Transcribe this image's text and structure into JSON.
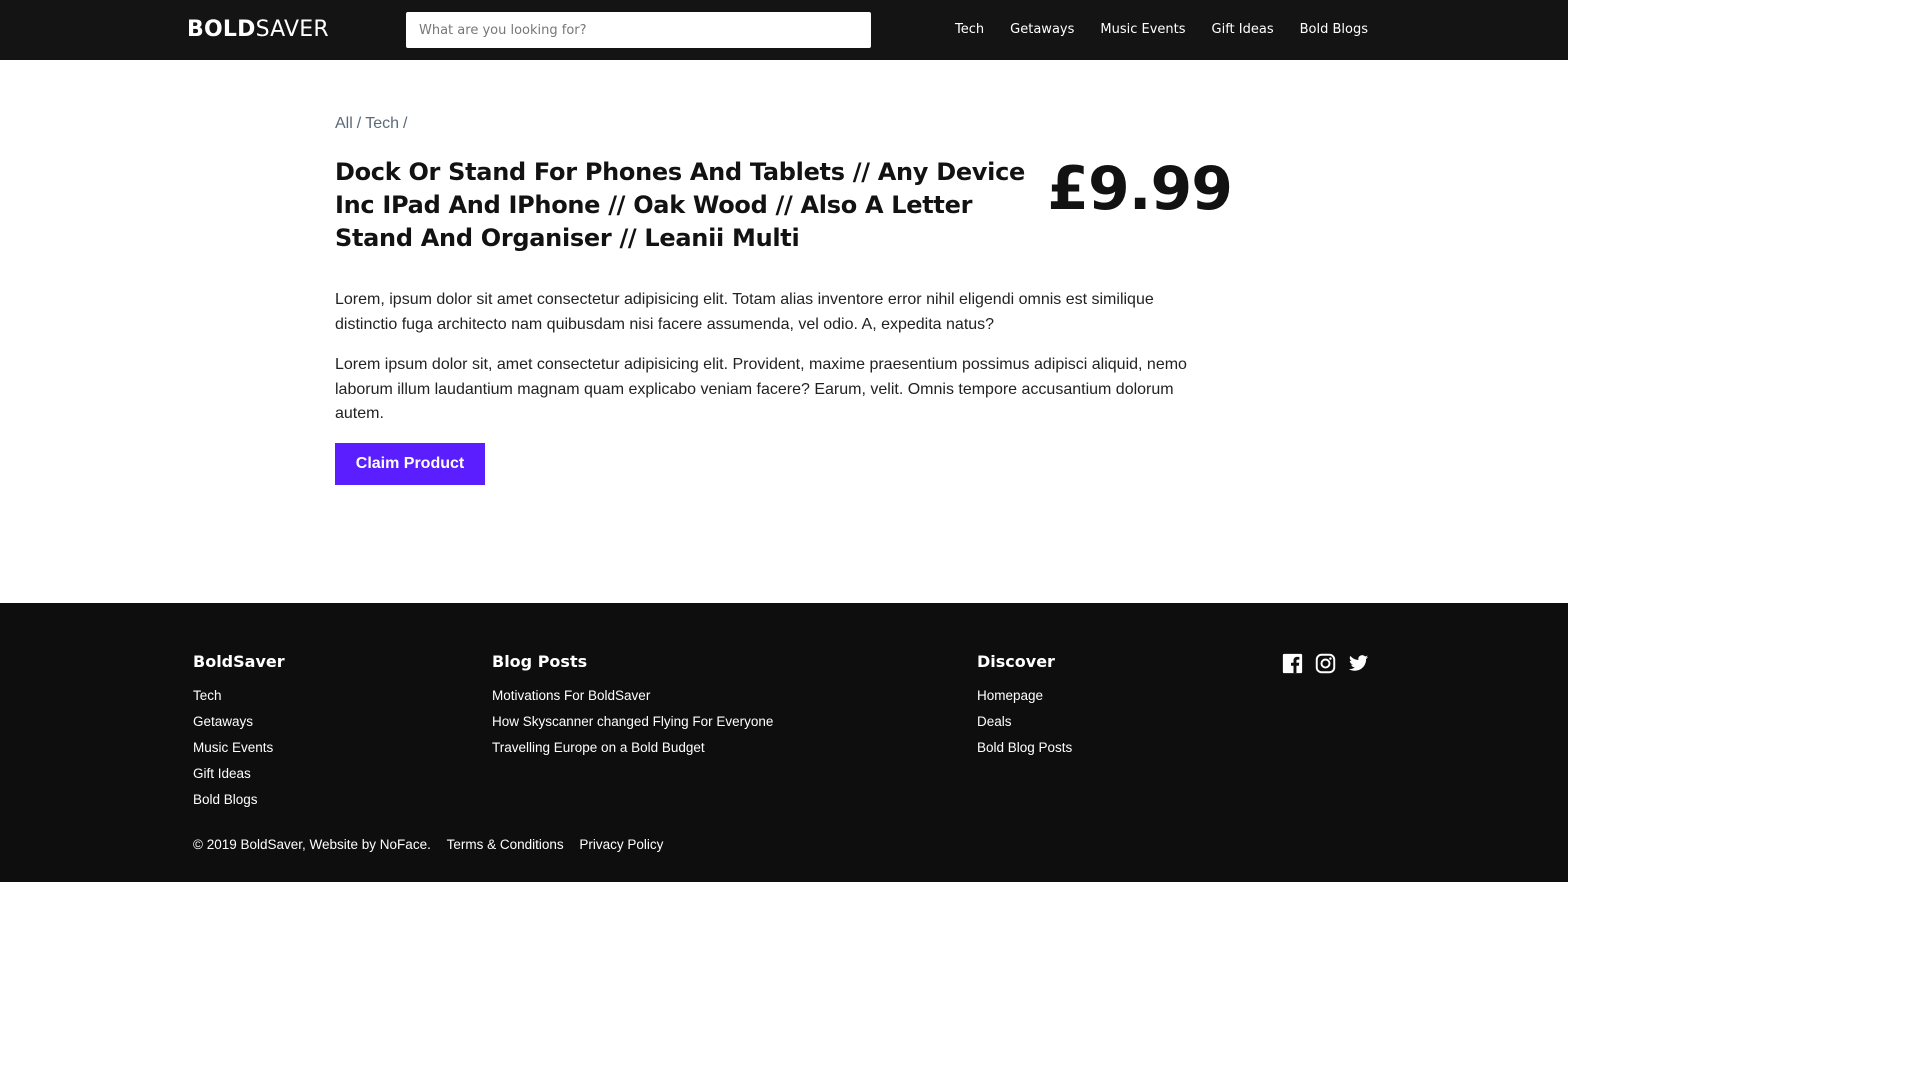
{
  "header": {
    "logo_bold": "BOLD",
    "logo_light": "SAVER",
    "search_placeholder": "What are you looking for?",
    "nav": [
      "Tech",
      "Getaways",
      "Music Events",
      "Gift Ideas",
      "Bold Blogs"
    ]
  },
  "breadcrumb": {
    "items": [
      "All",
      "Tech"
    ],
    "separator": "/"
  },
  "product": {
    "title": "Dock Or Stand For Phones And Tablets // Any Device Inc IPad And IPhone // Oak Wood // Also A Letter Stand And Organiser // Leanii Multi",
    "price": "£9.99",
    "paragraphs": [
      "Lorem, ipsum dolor sit amet consectetur adipisicing elit. Totam alias inventore error nihil eligendi omnis est similique distinctio fuga architecto nam quibusdam nisi facere assumenda, vel odio. A, expedita natus?",
      "Lorem ipsum dolor sit, amet consectetur adipisicing elit. Provident, maxime praesentium possimus adipisci aliquid, nemo laborum illum laudantium magnam quam explicabo veniam facere? Earum, velit. Omnis tempore accusantium dolorum autem."
    ],
    "claim_label": "Claim Product",
    "accent_color": "#5a1eff"
  },
  "footer": {
    "col1": {
      "heading": "BoldSaver",
      "links": [
        "Tech",
        "Getaways",
        "Music Events",
        "Gift Ideas",
        "Bold Blogs"
      ]
    },
    "col2": {
      "heading": "Blog Posts",
      "links": [
        "Motivations For BoldSaver",
        "How Skyscanner changed Flying For Everyone",
        "Travelling Europe on a Bold Budget"
      ]
    },
    "col3": {
      "heading": "Discover",
      "links": [
        "Homepage",
        "Deals",
        "Bold Blog Posts"
      ]
    },
    "social_icons": [
      "facebook-icon",
      "instagram-icon",
      "twitter-icon"
    ],
    "copyright": "© 2019 BoldSaver, Website by NoFace.",
    "terms": "Terms & Conditions",
    "privacy": "Privacy Policy"
  }
}
